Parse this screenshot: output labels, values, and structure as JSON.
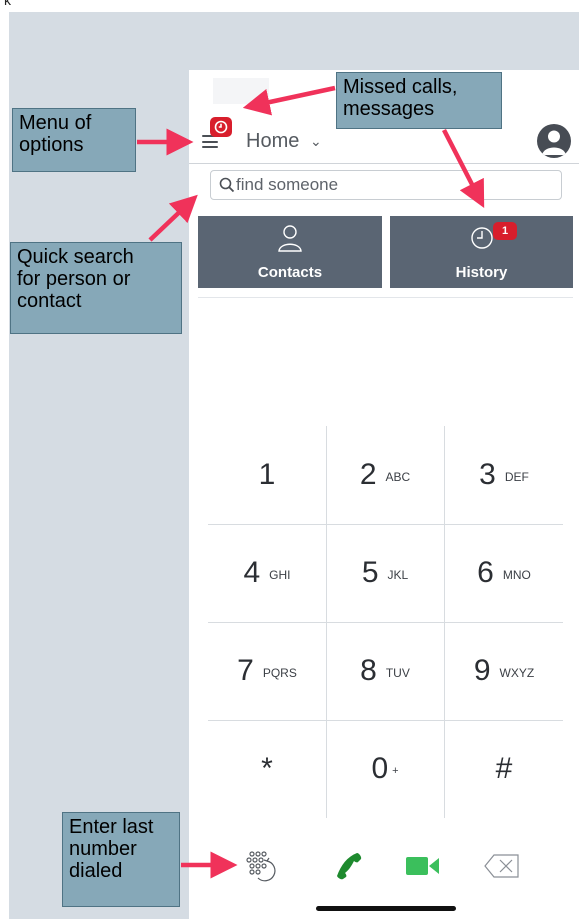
{
  "header": {
    "title": "Home"
  },
  "search": {
    "placeholder": "find someone"
  },
  "tabs": [
    {
      "label": "Contacts"
    },
    {
      "label": "History",
      "badge": "1"
    }
  ],
  "keypad": {
    "keys": [
      {
        "digit": "1",
        "letters": ""
      },
      {
        "digit": "2",
        "letters": "ABC"
      },
      {
        "digit": "3",
        "letters": "DEF"
      },
      {
        "digit": "4",
        "letters": "GHI"
      },
      {
        "digit": "5",
        "letters": "JKL"
      },
      {
        "digit": "6",
        "letters": "MNO"
      },
      {
        "digit": "7",
        "letters": "PQRS"
      },
      {
        "digit": "8",
        "letters": "TUV"
      },
      {
        "digit": "9",
        "letters": "WXYZ"
      },
      {
        "digit": "*",
        "letters": ""
      },
      {
        "digit": "0",
        "letters": "+"
      },
      {
        "digit": "#",
        "letters": ""
      }
    ]
  },
  "bottom_bar": {
    "icons": [
      "redial-icon",
      "phone-icon",
      "video-call-icon",
      "backspace-icon"
    ]
  },
  "annotations": {
    "menu": "Menu of\noptions",
    "missed": "Missed calls,\nmessages",
    "search": "Quick search\nfor person or\ncontact",
    "redial": "Enter last\nnumber\ndialed"
  },
  "colors": {
    "accent_red": "#d81e2c",
    "tab_bg": "#5a6573",
    "call_green": "#1e8a2e",
    "video_green": "#3bbf5c",
    "callout_bg": "#86a8b8",
    "arrow": "#f0325a"
  }
}
